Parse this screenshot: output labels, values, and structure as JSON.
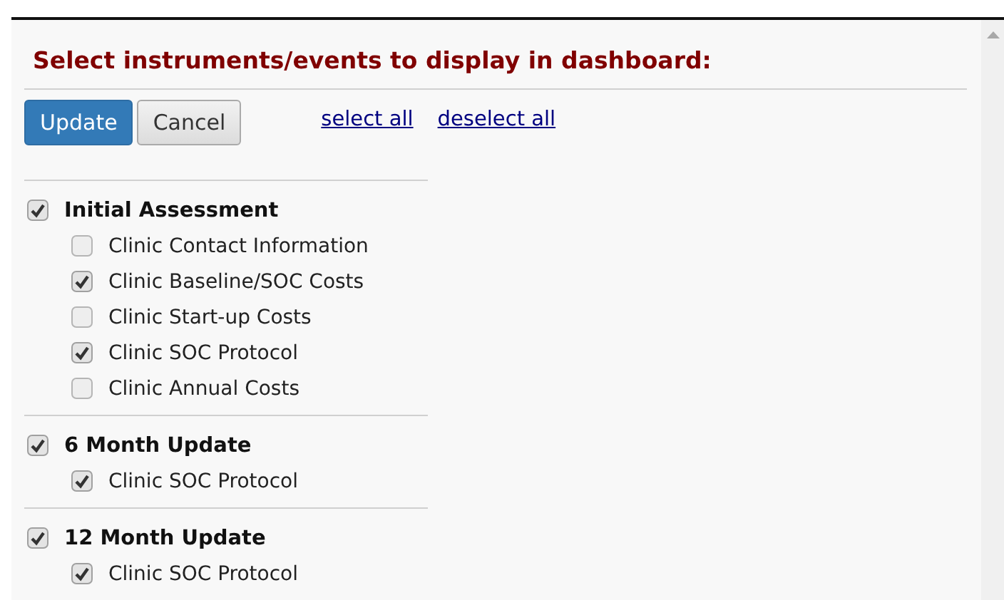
{
  "heading": "Select instruments/events to display in dashboard:",
  "buttons": [
    {
      "label": "Update",
      "kind": "primary"
    },
    {
      "label": "Cancel",
      "kind": "secondary"
    }
  ],
  "links": [
    "select all",
    "deselect all"
  ],
  "events": [
    {
      "label": "Initial Assessment",
      "checked": true,
      "instruments": [
        {
          "label": "Clinic Contact Information",
          "checked": false
        },
        {
          "label": "Clinic Baseline/SOC Costs",
          "checked": true
        },
        {
          "label": "Clinic Start-up Costs",
          "checked": false
        },
        {
          "label": "Clinic SOC Protocol",
          "checked": true
        },
        {
          "label": "Clinic Annual Costs",
          "checked": false
        }
      ]
    },
    {
      "label": "6 Month Update",
      "checked": true,
      "instruments": [
        {
          "label": "Clinic SOC Protocol",
          "checked": true
        }
      ]
    },
    {
      "label": "12 Month Update",
      "checked": true,
      "instruments": [
        {
          "label": "Clinic SOC Protocol",
          "checked": true
        }
      ]
    }
  ]
}
